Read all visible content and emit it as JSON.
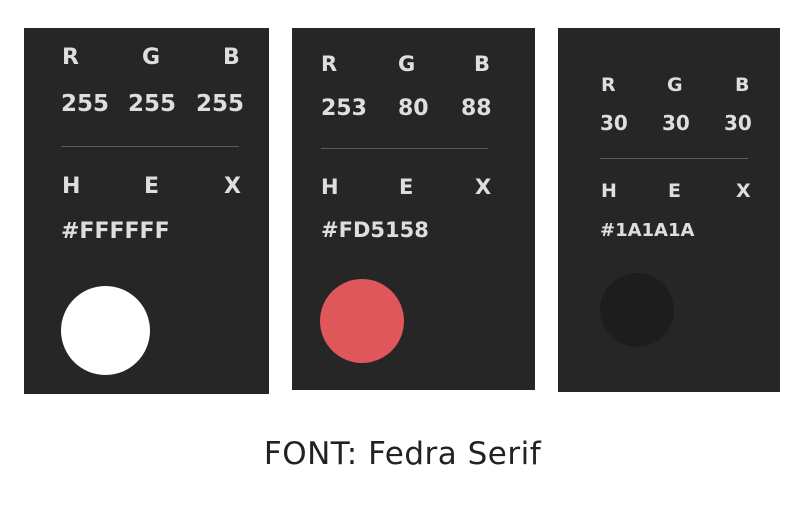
{
  "cards": [
    {
      "labels": {
        "r": "R",
        "g": "G",
        "b": "B",
        "h": "H",
        "e": "E",
        "x": "X"
      },
      "rgb": {
        "r": "255",
        "g": "255",
        "b": "255"
      },
      "hex": "#FFFFFF",
      "swatch_color": "#FFFFFF"
    },
    {
      "labels": {
        "r": "R",
        "g": "G",
        "b": "B",
        "h": "H",
        "e": "E",
        "x": "X"
      },
      "rgb": {
        "r": "253",
        "g": "80",
        "b": "88"
      },
      "hex": "#FD5158",
      "swatch_color": "#E0575B"
    },
    {
      "labels": {
        "r": "R",
        "g": "G",
        "b": "B",
        "h": "H",
        "e": "E",
        "x": "X"
      },
      "rgb": {
        "r": "30",
        "g": "30",
        "b": "30"
      },
      "hex": "#1A1A1A",
      "swatch_color": "#1D1D1D"
    }
  ],
  "caption": "FONT: Fedra Serif",
  "colors": {
    "card_bg": "#262626",
    "card_text": "#DEDEDE",
    "page_bg": "#FFFFFF"
  }
}
